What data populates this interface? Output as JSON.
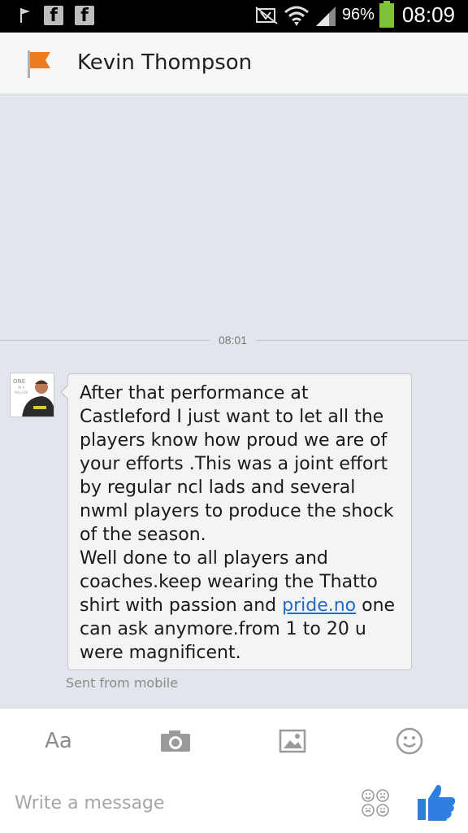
{
  "status_bar": {
    "battery_percent": "96%",
    "time": "08:09",
    "notification_icons": [
      "notification-arrow-icon",
      "facebook-icon",
      "facebook-icon"
    ],
    "system_icons": [
      "nfc-icon",
      "wifi-icon",
      "signal-icon",
      "battery-icon"
    ]
  },
  "header": {
    "title": "Kevin Thompson",
    "icon": "flag-icon",
    "flag_color": "#f07c1e"
  },
  "thread": {
    "timestamp": "08:01",
    "message": {
      "text_before_link": "After that performance at Castleford I just want to let all the players know how proud we are of your efforts .This was a joint effort by regular ncl lads and several nwml players to produce the shock of the season.\nWell done to all players and coaches.keep wearing the Thatto shirt with passion and ",
      "link_text": "pride.no",
      "text_after_link": " one can ask anymore.from 1 to 20 u were magnificent.",
      "meta": "Sent from mobile"
    },
    "avatar": {
      "caption_line1": "ONE",
      "caption_line2": "IN A",
      "caption_line3": "MILLION"
    }
  },
  "composer": {
    "tools": [
      {
        "name": "text-format",
        "label": "Aa"
      },
      {
        "name": "camera",
        "icon": "camera-icon"
      },
      {
        "name": "gallery",
        "icon": "image-icon"
      },
      {
        "name": "emoji",
        "icon": "smiley-icon"
      }
    ],
    "placeholder": "Write a message",
    "like_color": "#2f7fe0"
  }
}
